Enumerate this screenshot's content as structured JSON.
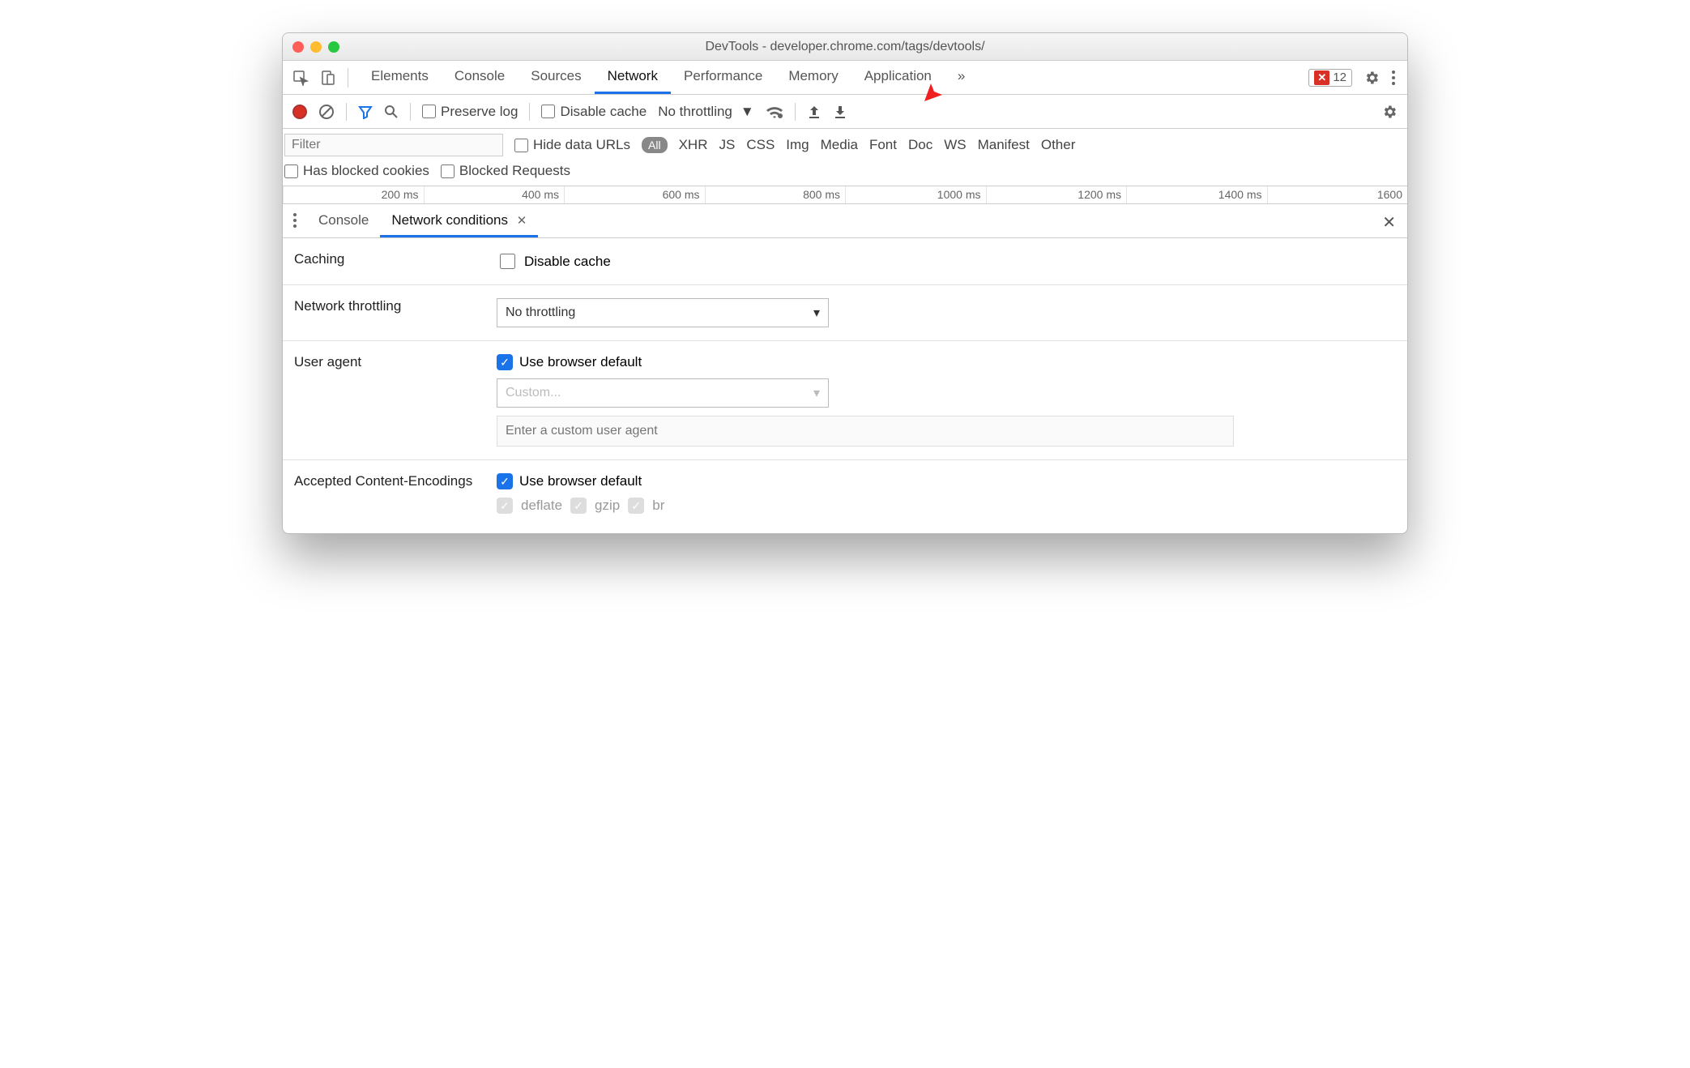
{
  "window": {
    "title": "DevTools - developer.chrome.com/tags/devtools/"
  },
  "tabs": {
    "items": [
      "Elements",
      "Console",
      "Sources",
      "Network",
      "Performance",
      "Memory",
      "Application"
    ],
    "active": "Network",
    "error_count": "12"
  },
  "toolbar": {
    "preserve_log": "Preserve log",
    "disable_cache": "Disable cache",
    "throttling": "No throttling"
  },
  "filter": {
    "placeholder": "Filter",
    "hide_data_urls": "Hide data URLs",
    "all": "All",
    "types": [
      "XHR",
      "JS",
      "CSS",
      "Img",
      "Media",
      "Font",
      "Doc",
      "WS",
      "Manifest",
      "Other"
    ],
    "has_blocked": "Has blocked cookies",
    "blocked_req": "Blocked Requests"
  },
  "timescale": [
    "200 ms",
    "400 ms",
    "600 ms",
    "800 ms",
    "1000 ms",
    "1200 ms",
    "1400 ms",
    "1600 "
  ],
  "drawer": {
    "tabs": [
      "Console",
      "Network conditions"
    ],
    "active": "Network conditions"
  },
  "conditions": {
    "caching_label": "Caching",
    "disable_cache": "Disable cache",
    "throttling_label": "Network throttling",
    "throttling_value": "No throttling",
    "ua_label": "User agent",
    "ua_default": "Use browser default",
    "ua_custom": "Custom...",
    "ua_placeholder": "Enter a custom user agent",
    "enc_label": "Accepted Content-Encodings",
    "enc_default": "Use browser default",
    "encodings": [
      "deflate",
      "gzip",
      "br"
    ]
  }
}
